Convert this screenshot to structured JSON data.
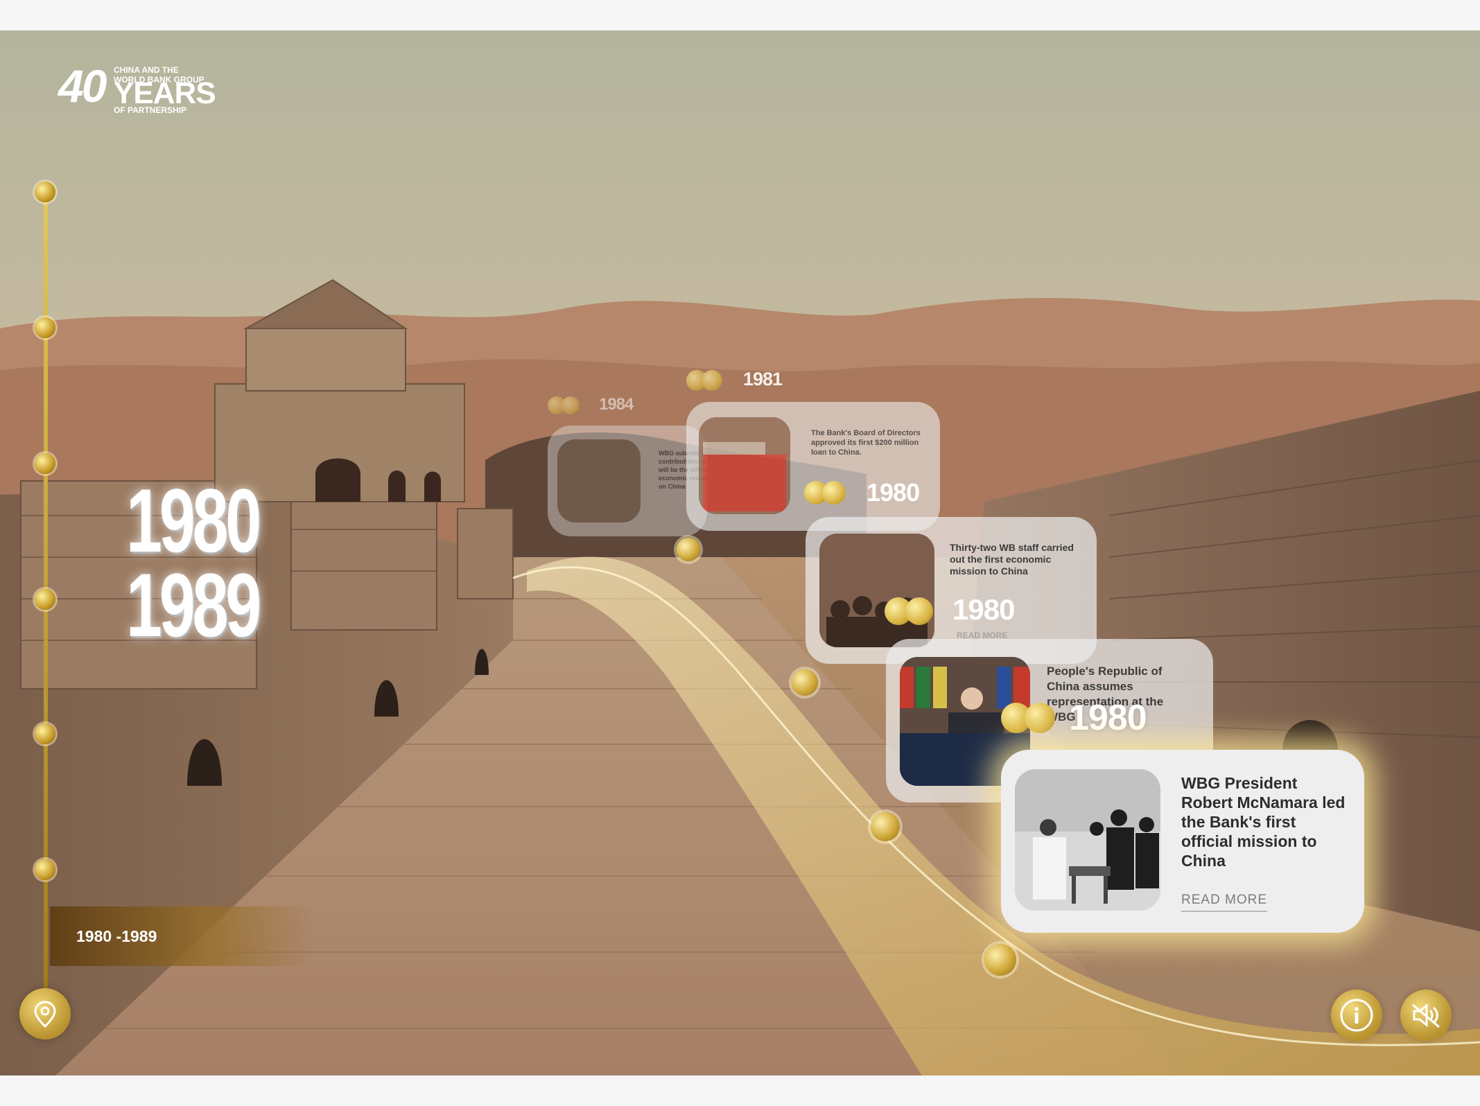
{
  "logo": {
    "number": "40",
    "line1": "CHINA AND THE",
    "line2": "WORLD BANK GROUP",
    "years": "YEARS",
    "line3": "OF PARTNERSHIP"
  },
  "decade_heading": {
    "start": "1980",
    "end": "1989"
  },
  "decade_nav": {
    "label": "1980 -1989"
  },
  "timeline_cards": [
    {
      "year": "1984",
      "text": "WBG submits its contributions to China that will be the different major economic research study on China"
    },
    {
      "year": "1981",
      "text": "The Bank's Board of Directors approved its first $200 million loan to China."
    },
    {
      "year": "1980",
      "text": "Thirty-two WB staff carried out the first economic mission to China",
      "read_more": "READ MORE"
    },
    {
      "year": "1980",
      "text": "People's Republic of China assumes representation at the WBG"
    }
  ],
  "featured_card": {
    "title": "WBG President Robert McNamara led the Bank's first official mission to China",
    "read_more": "READ MORE"
  },
  "colors": {
    "gold": "#c9a23a",
    "card_bg": "#eeeeee",
    "text_dark": "#2d2d2d"
  },
  "icons": {
    "location": "map-pin-icon",
    "info": "info-icon",
    "mute": "speaker-muted-icon"
  }
}
